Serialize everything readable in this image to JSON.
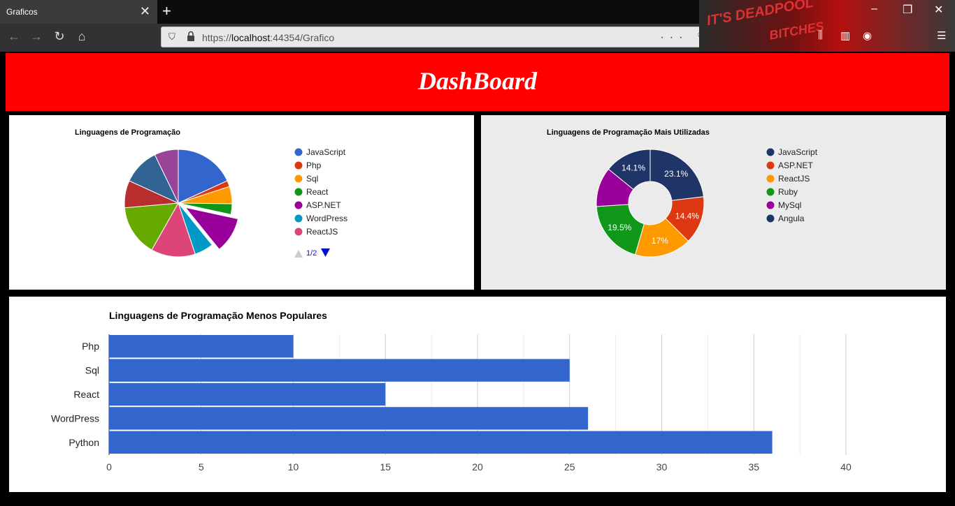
{
  "browser": {
    "tab_title": "Graficos",
    "tab_close": "✕",
    "new_tab": "+",
    "url_protocol": "https://",
    "url_host": "localhost",
    "url_rest": ":44354/Grafico",
    "url_actions": "··· ♡ ☆",
    "deco_text_1": "IT'S DEADPOOL",
    "deco_text_2": "BITCHES"
  },
  "page": {
    "title": "DashBoard"
  },
  "chart_data": [
    {
      "type": "pie",
      "title": "Linguagens de Programação",
      "slices": [
        {
          "label": "JavaScript",
          "value": 18.2,
          "color": "#3366cc"
        },
        {
          "label": "Php",
          "value": 1.8,
          "color": "#dc3912"
        },
        {
          "label": "Sql",
          "value": 5.2,
          "color": "#ff9900"
        },
        {
          "label": "React",
          "value": 3.2,
          "color": "#109618"
        },
        {
          "label": "ASP.NET",
          "value": 10.8,
          "color": "#990099",
          "offset": true
        },
        {
          "label": "WordPress",
          "value": 5.7,
          "color": "#0099c6"
        },
        {
          "label": "ReactJS",
          "value": 13.3,
          "color": "#dd4477"
        },
        {
          "label": "",
          "value": 15.4,
          "color": "#66aa00"
        },
        {
          "label": "",
          "value": 8.2,
          "color": "#b82e2e"
        },
        {
          "label": "",
          "value": 11.0,
          "color": "#316395"
        },
        {
          "label": "",
          "value": 7.2,
          "color": "#994499"
        }
      ],
      "legend_visible": [
        "JavaScript",
        "Php",
        "Sql",
        "React",
        "ASP.NET",
        "WordPress",
        "ReactJS"
      ],
      "legend_page": "1/2",
      "legend_position": "right"
    },
    {
      "type": "pie",
      "title": "Linguagens de Programação Mais Utilizadas",
      "donut": true,
      "slices": [
        {
          "label": "JavaScript",
          "value": 23.1,
          "color": "#1f3568",
          "display": "23.1%"
        },
        {
          "label": "ASP.NET",
          "value": 14.4,
          "color": "#dc3912",
          "display": "14.4%"
        },
        {
          "label": "ReactJS",
          "value": 17,
          "color": "#ff9900",
          "display": "17%"
        },
        {
          "label": "Ruby",
          "value": 19.5,
          "color": "#109618",
          "display": "19.5%"
        },
        {
          "label": "MySql",
          "value": 11.9,
          "color": "#990099",
          "display": ""
        },
        {
          "label": "Angula",
          "value": 14.1,
          "color": "#1f3568",
          "display": "14.1%"
        }
      ],
      "legend_position": "right"
    },
    {
      "type": "bar",
      "orientation": "horizontal",
      "title": "Linguagens de Programação Menos Populares",
      "categories": [
        "Php",
        "Sql",
        "React",
        "WordPress",
        "Python"
      ],
      "values": [
        10,
        25,
        15,
        26,
        36
      ],
      "color": "#3366cc",
      "xlim": [
        0,
        40
      ],
      "xticks": [
        "0",
        "5",
        "10",
        "15",
        "20",
        "25",
        "30",
        "35",
        "40"
      ],
      "grid": true
    }
  ]
}
